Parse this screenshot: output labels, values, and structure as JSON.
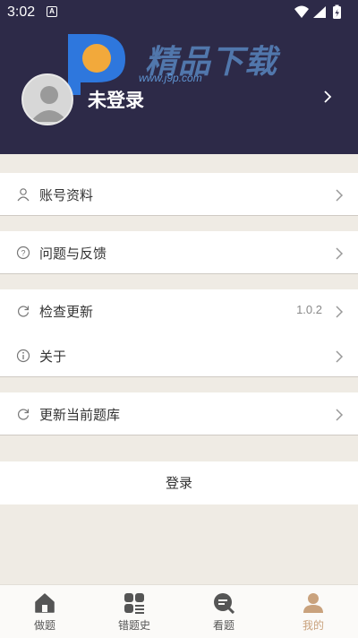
{
  "status_bar": {
    "time": "3:02",
    "notif_badge": "A"
  },
  "watermark": {
    "brand_text": "精品下载",
    "url": "www.j9p.com"
  },
  "profile": {
    "username": "未登录"
  },
  "menu": {
    "account": {
      "label": "账号资料"
    },
    "feedback": {
      "label": "问题与反馈"
    },
    "check_update": {
      "label": "检查更新",
      "version": "1.0.2"
    },
    "about": {
      "label": "关于"
    },
    "update_bank": {
      "label": "更新当前题库"
    }
  },
  "login_label": "登录",
  "tabs": [
    {
      "label": "做题",
      "icon": "home-icon",
      "active": false
    },
    {
      "label": "错题史",
      "icon": "grid-list-icon",
      "active": false
    },
    {
      "label": "看题",
      "icon": "search-list-icon",
      "active": false
    },
    {
      "label": "我的",
      "icon": "person-icon",
      "active": true
    }
  ],
  "colors": {
    "header_bg": "#2d2a48",
    "page_bg": "#efebe4",
    "active_tab": "#c9a27d"
  }
}
